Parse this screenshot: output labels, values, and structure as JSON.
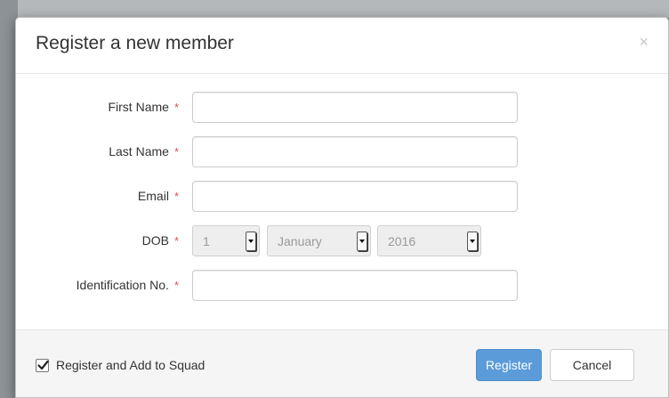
{
  "modal": {
    "title": "Register a new member",
    "close_glyph": "×"
  },
  "form": {
    "required_marker": "*",
    "first_name": {
      "label": "First Name",
      "value": "",
      "placeholder": ""
    },
    "last_name": {
      "label": "Last Name",
      "value": "",
      "placeholder": ""
    },
    "email": {
      "label": "Email",
      "value": "",
      "placeholder": ""
    },
    "dob": {
      "label": "DOB",
      "day": "1",
      "month": "January",
      "year": "2016"
    },
    "identification": {
      "label": "Identification No.",
      "value": "",
      "placeholder": ""
    }
  },
  "footer": {
    "checkbox_label": "Register and Add to Squad",
    "checkbox_checked": true,
    "register_label": "Register",
    "cancel_label": "Cancel"
  },
  "colors": {
    "primary": "#5b9bd9",
    "required": "#d9534f"
  }
}
